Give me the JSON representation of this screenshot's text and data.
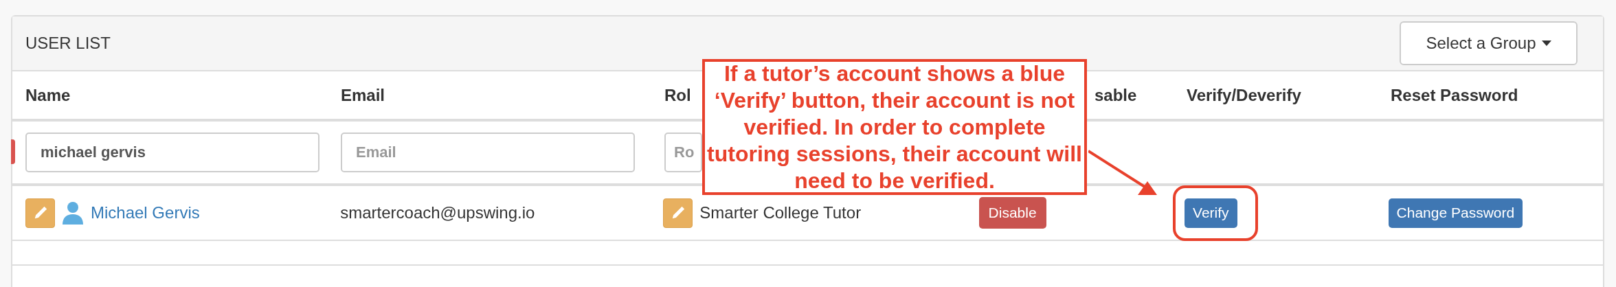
{
  "panel": {
    "title": "USER LIST",
    "group_select": "Select a Group"
  },
  "table": {
    "columns": [
      "Name",
      "Email",
      "Rol",
      "sable",
      "Verify/Deverify",
      "Reset Password"
    ],
    "filters": [
      {
        "value": "michael gervis"
      },
      {
        "placeholder": "Email"
      },
      {
        "placeholder": "Ro"
      }
    ],
    "rows": [
      {
        "name": "Michael Gervis",
        "email": "smartercoach@upswing.io",
        "role": "Smarter College Tutor",
        "disable": "Disable",
        "verify": "Verify",
        "reset": "Change Password"
      }
    ]
  },
  "callout": {
    "text": "If a tutor’s account shows a blue ‘Verify’ button, their account is not verified. In order to complete tutoring sessions, their account will need to be verified."
  }
}
